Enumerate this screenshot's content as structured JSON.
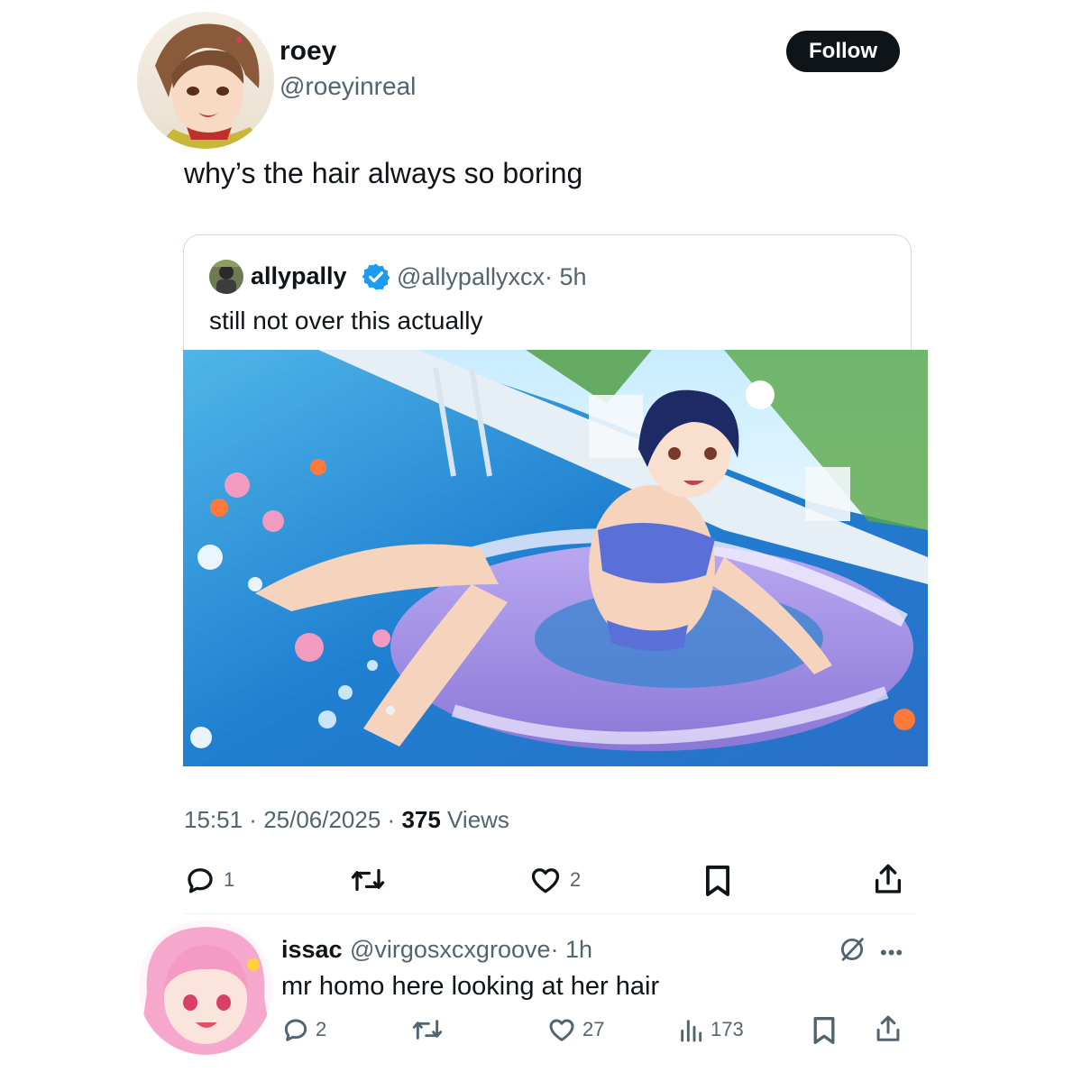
{
  "main_tweet": {
    "author_name": "roey",
    "author_handle": "@roeyinreal",
    "follow_label": "Follow",
    "text": "why’s the hair always so boring",
    "meta": {
      "time": "15:51",
      "separator": " · ",
      "date": "25/06/2025",
      "views_count": "375",
      "views_label": " Views"
    },
    "actions": {
      "reply_count": "1",
      "retweet_count": "",
      "like_count": "2"
    }
  },
  "quoted_tweet": {
    "author_name": "allypally",
    "author_handle": "@allypallyxcx",
    "age": "· 5h",
    "text": "still not over this actually"
  },
  "reply": {
    "author_name": "issac",
    "author_handle": "@virgosxcxgroove",
    "age": "· 1h",
    "text": "mr homo here looking at her hair",
    "actions": {
      "reply_count": "2",
      "like_count": "27",
      "views_count": "173"
    }
  },
  "colors": {
    "text_primary": "#0f1419",
    "text_secondary": "#536471",
    "verified_blue": "#1d9bf0",
    "border": "#cfd9de"
  },
  "icons": [
    "reply-icon",
    "retweet-icon",
    "like-icon",
    "bookmark-icon",
    "share-icon",
    "views-icon",
    "grok-icon",
    "more-icon",
    "verified-badge-icon"
  ]
}
